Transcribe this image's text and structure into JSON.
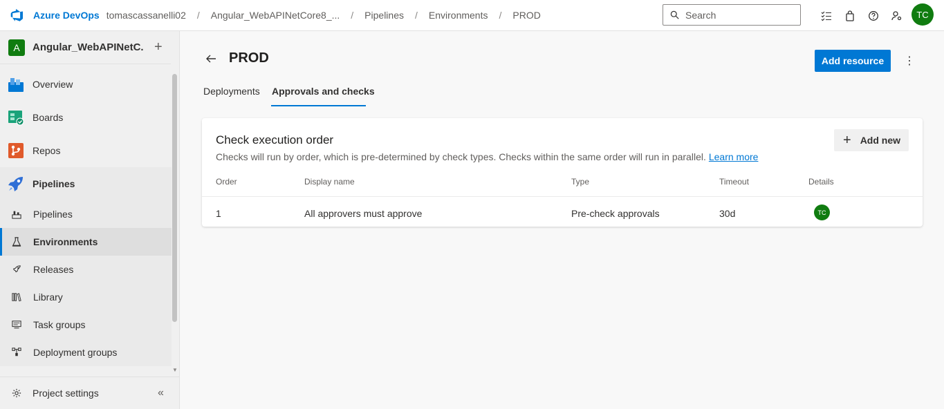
{
  "topbar": {
    "brand": "Azure DevOps",
    "breadcrumbs": [
      "tomascassanelli02",
      "Angular_WebAPINetCore8_...",
      "Pipelines",
      "Environments",
      "PROD"
    ],
    "breadcrumb_separator": "/",
    "search_placeholder": "Search",
    "user_initials": "TC",
    "icons": [
      "task-list-icon",
      "shopping-bag-icon",
      "help-icon",
      "user-settings-icon"
    ]
  },
  "sidebar": {
    "project_initial": "A",
    "project_name": "Angular_WebAPINetC...",
    "add_label": "+",
    "items": [
      {
        "label": "Overview",
        "icon": "overview-icon"
      },
      {
        "label": "Boards",
        "icon": "boards-icon"
      },
      {
        "label": "Repos",
        "icon": "repos-icon"
      },
      {
        "label": "Pipelines",
        "icon": "pipelines-icon"
      },
      {
        "label": "Pipelines",
        "icon": "pipelines-sub-icon"
      },
      {
        "label": "Environments",
        "icon": "environments-icon"
      },
      {
        "label": "Releases",
        "icon": "releases-icon"
      },
      {
        "label": "Library",
        "icon": "library-icon"
      },
      {
        "label": "Task groups",
        "icon": "task-groups-icon"
      },
      {
        "label": "Deployment groups",
        "icon": "deployment-groups-icon"
      }
    ],
    "footer_label": "Project settings",
    "collapse_label": "«"
  },
  "page": {
    "title": "PROD",
    "add_resource_label": "Add resource",
    "more_label": "⋮",
    "tabs": [
      {
        "label": "Deployments",
        "active": false
      },
      {
        "label": "Approvals and checks",
        "active": true
      }
    ]
  },
  "card": {
    "title": "Check execution order",
    "subtitle": "Checks will run by order, which is pre-determined by check types. Checks within the same order will run in parallel.",
    "learn_more": "Learn more",
    "add_new_label": "Add new",
    "columns": [
      "Order",
      "Display name",
      "Type",
      "Timeout",
      "Details"
    ],
    "rows": [
      {
        "order": "1",
        "display_name": "All approvers must approve",
        "type": "Pre-check approvals",
        "timeout": "30d",
        "details_initials": "TC"
      }
    ]
  },
  "colors": {
    "accent": "#0078d4",
    "avatar": "#107c10"
  }
}
